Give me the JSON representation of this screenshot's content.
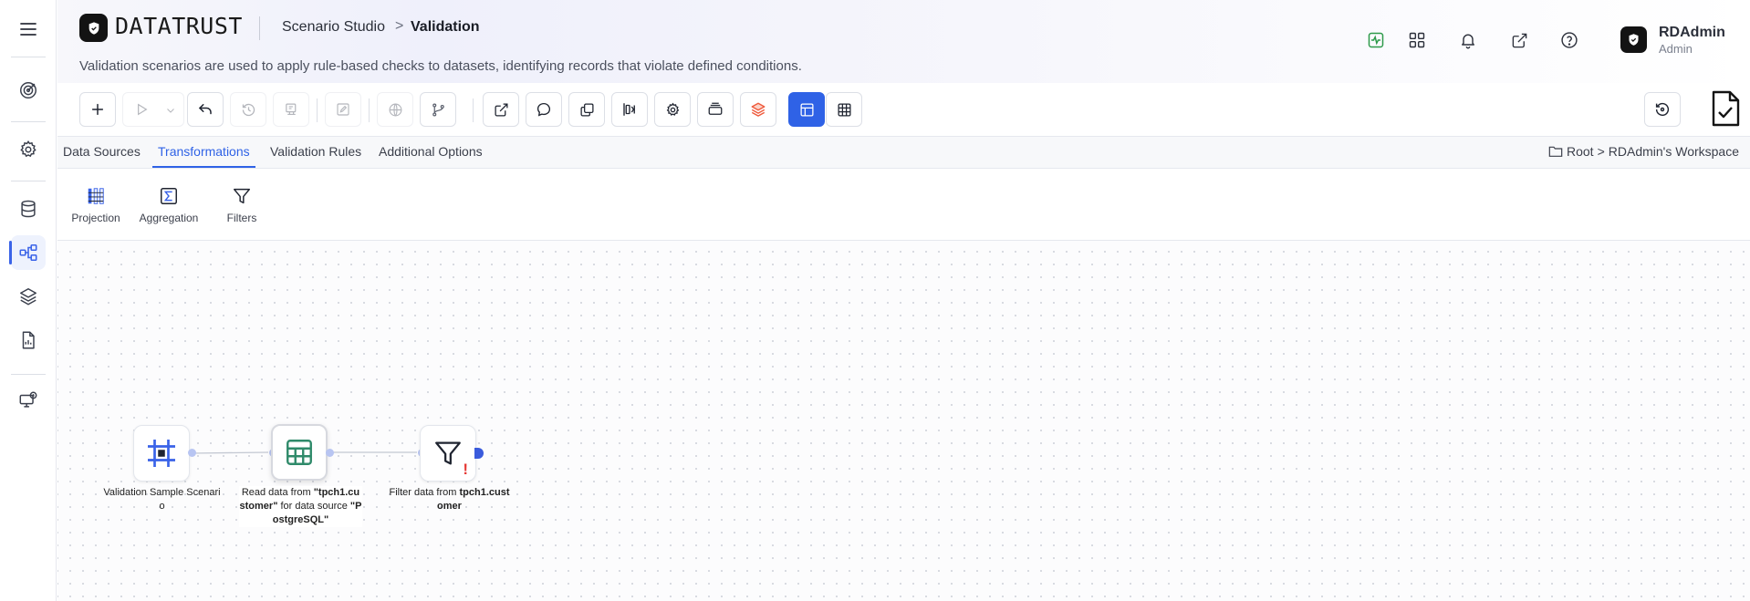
{
  "brand": {
    "name": "DATATRUST"
  },
  "breadcrumb": {
    "parent": "Scenario Studio",
    "separator": ">",
    "current": "Validation"
  },
  "description": "Validation scenarios are used to apply rule-based checks to datasets, identifying records that violate defined conditions.",
  "header_icons": [
    "activity-icon",
    "apps-grid-icon",
    "bell-icon",
    "external-link-icon",
    "help-icon"
  ],
  "user": {
    "name": "RDAdmin",
    "role": "Admin"
  },
  "sidebar": {
    "items": [
      "target-icon",
      "gear-icon",
      "database-icon",
      "flow-icon",
      "layers-icon",
      "report-icon",
      "monitor-icon"
    ],
    "active": "flow-icon"
  },
  "toolbar": {
    "buttons": [
      "add",
      "run",
      "undo",
      "history",
      "deploy",
      "edit",
      "globe",
      "branch",
      "open",
      "comment",
      "copy",
      "align",
      "settings",
      "layers-stack",
      "layers-orange",
      "layout",
      "table"
    ]
  },
  "tabs": [
    {
      "label": "Data Sources",
      "active": false
    },
    {
      "label": "Transformations",
      "active": true
    },
    {
      "label": "Validation Rules",
      "active": false
    },
    {
      "label": "Additional Options",
      "active": false
    }
  ],
  "workspace": {
    "root": "Root",
    "sep": ">",
    "name": "RDAdmin's Workspace"
  },
  "palette": [
    {
      "label": "Projection",
      "icon": "projection-icon"
    },
    {
      "label": "Aggregation",
      "icon": "sigma-icon"
    },
    {
      "label": "Filters",
      "icon": "filter-icon"
    }
  ],
  "nodes": [
    {
      "id": "start",
      "label": "Validation Sample Scenario",
      "icon": "frame-icon"
    },
    {
      "id": "read",
      "label_pre": "Read data from ",
      "label_b1": "\"tpch1.customer\"",
      "label_mid": " for data source ",
      "label_b2": "\"PostgreSQL\"",
      "icon": "table-icon"
    },
    {
      "id": "filter",
      "label_pre": "Filter data from ",
      "label_b1": "tpch1.customer",
      "icon": "filter-icon",
      "warning": "!"
    }
  ],
  "colors": {
    "accent": "#2f62e6",
    "warning": "#e53935",
    "table_green": "#2f8a6a"
  }
}
